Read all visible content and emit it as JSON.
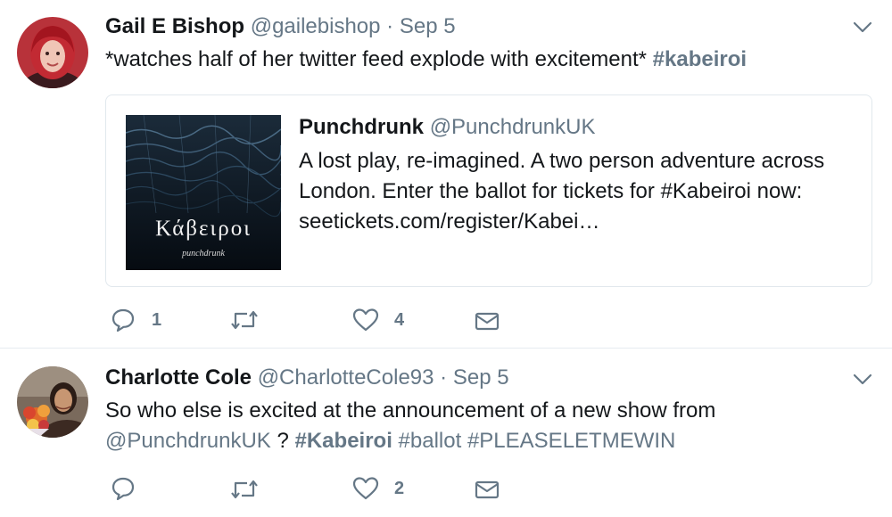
{
  "tweets": [
    {
      "author_name": "Gail E Bishop",
      "handle": "@gailebishop",
      "separator": "·",
      "date": "Sep 5",
      "text_plain": "*watches half of her twitter feed explode with excitement*",
      "hashtag": "#kabeiroi",
      "card": {
        "title": "Punchdrunk",
        "handle": "@PunchdrunkUK",
        "line1": "A lost play, re-imagined. A two person adventure across",
        "line2": "London. Enter the ballot for tickets for #Kabeiroi now:",
        "line3": "seetickets.com/register/Kabei…",
        "image_title": "Κάβειροι",
        "image_subtitle": "punchdrunk"
      },
      "replies": "1",
      "retweets": "",
      "likes": "4"
    },
    {
      "author_name": "Charlotte Cole",
      "handle": "@CharlotteCole93",
      "separator": "·",
      "date": "Sep 5",
      "line1": "So who else is excited at the announcement of a new show from",
      "mention": "@PunchdrunkUK",
      "question": "?",
      "tag1": "#Kabeiroi",
      "tag2": "#ballot",
      "tag3": "#PLEASELETMEWIN",
      "replies": "",
      "retweets": "",
      "likes": "2"
    }
  ],
  "colors": {
    "text": "#14171a",
    "muted": "#657786",
    "border": "#e1e8ed"
  },
  "icons": [
    "reply-icon",
    "retweet-icon",
    "like-icon",
    "message-icon",
    "chevron-down-icon"
  ]
}
